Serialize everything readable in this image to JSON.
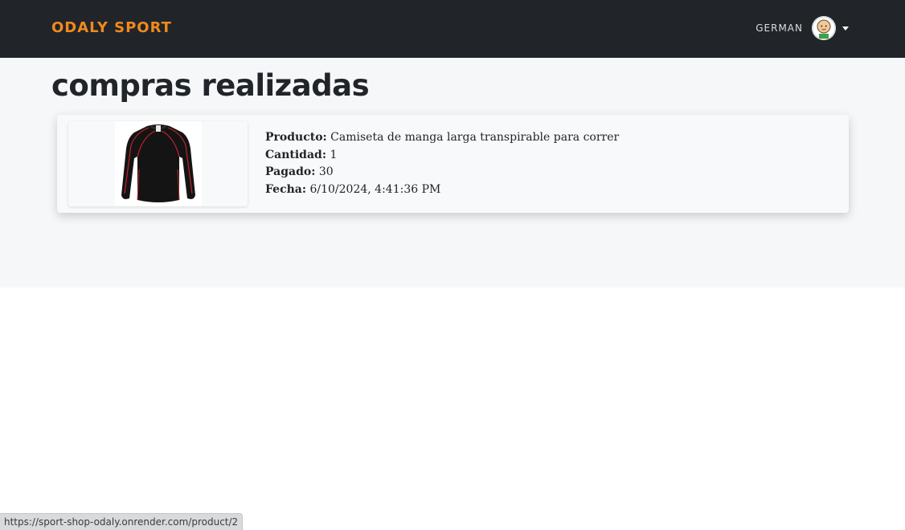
{
  "navbar": {
    "brand": "ODALY SPORT",
    "username": "GERMAN",
    "avatar_icon": "user-avatar-icon",
    "dropdown_icon": "caret-down-icon"
  },
  "page": {
    "title": "compras realizadas"
  },
  "purchases": [
    {
      "image_icon": "long-sleeve-shirt-image",
      "labels": {
        "product": "Producto:",
        "quantity": "Cantidad:",
        "paid": "Pagado:",
        "date": "Fecha:"
      },
      "product": "Camiseta de manga larga transpirable para correr",
      "quantity": "1",
      "paid": "30",
      "date": "6/10/2024, 4:41:36 PM"
    }
  ],
  "status_bar": {
    "url": "https://sport-shop-odaly.onrender.com/product/2"
  },
  "colors": {
    "navbar_bg": "#212429",
    "brand": "#f08a1c",
    "page_bg": "#f6f7f9"
  }
}
